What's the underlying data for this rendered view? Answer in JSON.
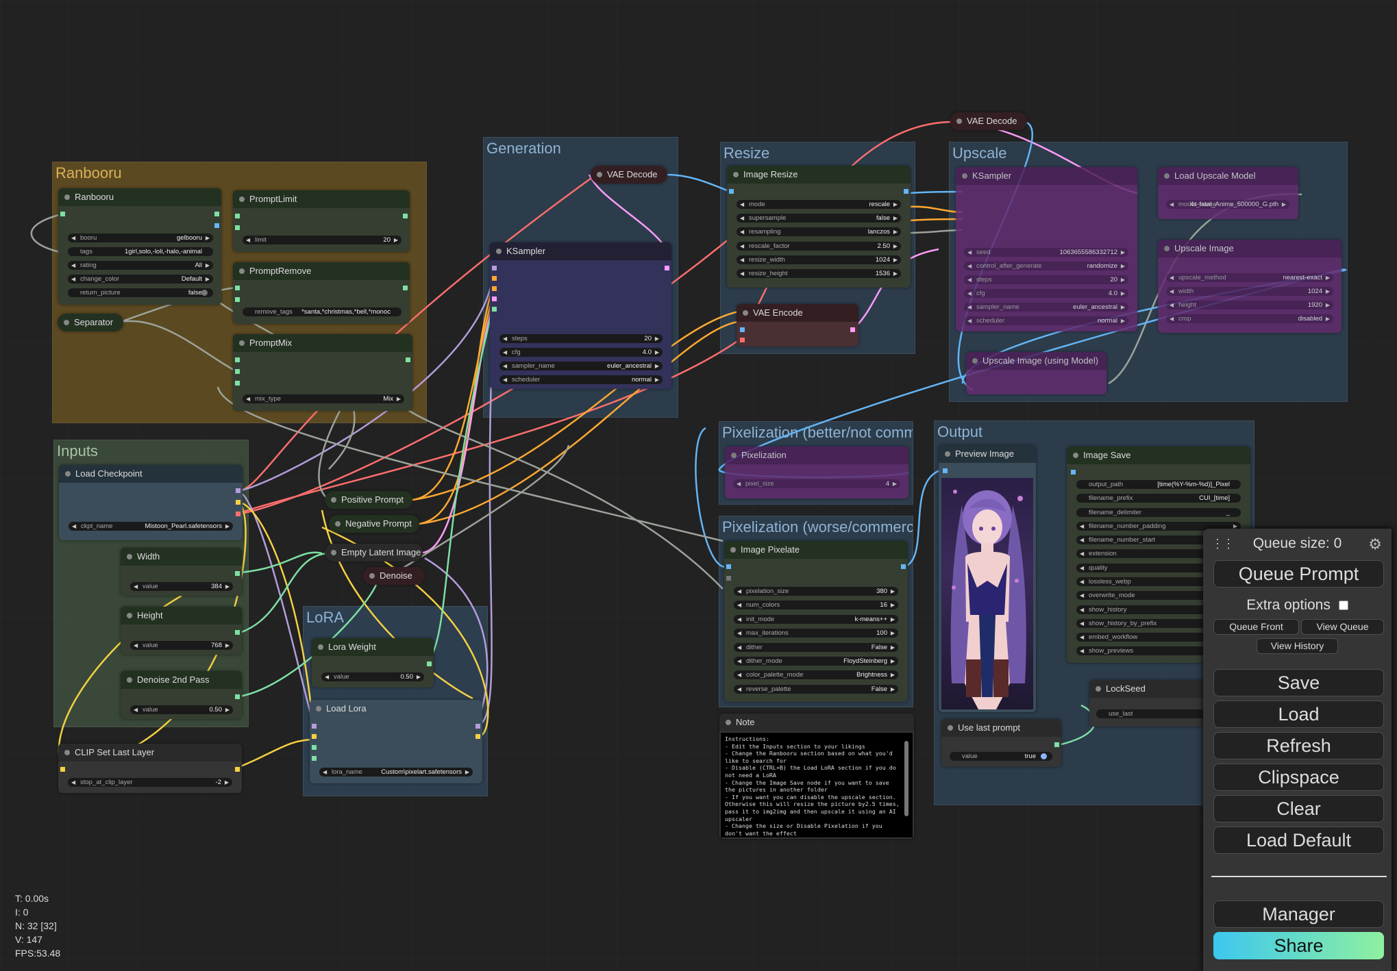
{
  "groups": {
    "ranbooru": "Ranbooru",
    "inputs": "Inputs",
    "generation": "Generation",
    "resize": "Resize",
    "upscale": "Upscale",
    "lora": "LoRA",
    "pix_better": "Pixelization (better/not commercial)",
    "pix_worse": "Pixelization (worse/commercial)",
    "output": "Output"
  },
  "nodes": {
    "ranbooru": {
      "title": "Ranbooru",
      "widgets": [
        {
          "name": "booru",
          "value": "gelbooru"
        },
        {
          "name": "tags",
          "value": "1girl,solo,-loli,-halo,-animal"
        },
        {
          "name": "rating",
          "value": "All"
        },
        {
          "name": "change_color",
          "value": "Default"
        },
        {
          "name": "return_picture",
          "value": "false"
        }
      ]
    },
    "separator": {
      "title": "Separator"
    },
    "promptlimit": {
      "title": "PromptLimit",
      "widgets": [
        {
          "name": "limit",
          "value": "20"
        }
      ]
    },
    "promptremove": {
      "title": "PromptRemove",
      "widgets": [
        {
          "name": "remove_tags",
          "value": "*santa,*christmas,*bell,*monoc"
        }
      ]
    },
    "promptmix": {
      "title": "PromptMix",
      "widgets": [
        {
          "name": "mix_type",
          "value": "Mix"
        }
      ]
    },
    "loadcheckpoint": {
      "title": "Load Checkpoint",
      "widgets": [
        {
          "name": "ckpt_name",
          "value": "Mistoon_Pearl.safetensors"
        }
      ]
    },
    "width": {
      "title": "Width",
      "widgets": [
        {
          "name": "value",
          "value": "384"
        }
      ]
    },
    "height": {
      "title": "Height",
      "widgets": [
        {
          "name": "value",
          "value": "768"
        }
      ]
    },
    "denoise2": {
      "title": "Denoise 2nd Pass",
      "widgets": [
        {
          "name": "value",
          "value": "0.50"
        }
      ]
    },
    "clipsetlast": {
      "title": "CLIP Set Last Layer",
      "widgets": [
        {
          "name": "stop_at_clip_layer",
          "value": "-2"
        }
      ]
    },
    "positive": {
      "title": "Positive Prompt"
    },
    "negative": {
      "title": "Negative Prompt"
    },
    "emptylatent": {
      "title": "Empty Latent Image"
    },
    "denoise": {
      "title": "Denoise"
    },
    "loraweight": {
      "title": "Lora Weight",
      "widgets": [
        {
          "name": "value",
          "value": "0.50"
        }
      ]
    },
    "loadlora": {
      "title": "Load Lora",
      "widgets": [
        {
          "name": "lora_name",
          "value": "Custom\\pixelart.safetensors"
        }
      ]
    },
    "vaedecode1": {
      "title": "VAE Decode"
    },
    "ksampler": {
      "title": "KSampler",
      "widgets": [
        {
          "name": "steps",
          "value": "20"
        },
        {
          "name": "cfg",
          "value": "4.0"
        },
        {
          "name": "sampler_name",
          "value": "euler_ancestral"
        },
        {
          "name": "scheduler",
          "value": "normal"
        }
      ]
    },
    "imageresize": {
      "title": "Image Resize",
      "widgets": [
        {
          "name": "mode",
          "value": "rescale"
        },
        {
          "name": "supersample",
          "value": "false"
        },
        {
          "name": "resampling",
          "value": "lanczos"
        },
        {
          "name": "rescale_factor",
          "value": "2.50"
        },
        {
          "name": "resize_width",
          "value": "1024"
        },
        {
          "name": "resize_height",
          "value": "1536"
        }
      ]
    },
    "vaeencode": {
      "title": "VAE Encode"
    },
    "vaedecode2": {
      "title": "VAE Decode"
    },
    "ksampler2": {
      "title": "KSampler",
      "widgets": [
        {
          "name": "seed",
          "value": "1063655586332712"
        },
        {
          "name": "control_after_generate",
          "value": "randomize"
        },
        {
          "name": "steps",
          "value": "20"
        },
        {
          "name": "cfg",
          "value": "4.0"
        },
        {
          "name": "sampler_name",
          "value": "euler_ancestral"
        },
        {
          "name": "scheduler",
          "value": "normal"
        }
      ]
    },
    "loadupscale": {
      "title": "Load Upscale Model",
      "widgets": [
        {
          "name": "model_name",
          "value": "4x-fatal_Anime_500000_G.pth"
        }
      ]
    },
    "upscaleimage": {
      "title": "Upscale Image",
      "widgets": [
        {
          "name": "upscale_method",
          "value": "nearest-exact"
        },
        {
          "name": "width",
          "value": "1024"
        },
        {
          "name": "height",
          "value": "1920"
        },
        {
          "name": "crop",
          "value": "disabled"
        }
      ]
    },
    "upscalemodel": {
      "title": "Upscale Image (using Model)"
    },
    "pixelization": {
      "title": "Pixelization",
      "widgets": [
        {
          "name": "pixel_size",
          "value": "4"
        }
      ]
    },
    "imagepixelate": {
      "title": "Image Pixelate",
      "widgets": [
        {
          "name": "pixelation_size",
          "value": "380"
        },
        {
          "name": "num_colors",
          "value": "16"
        },
        {
          "name": "init_mode",
          "value": "k-means++"
        },
        {
          "name": "max_iterations",
          "value": "100"
        },
        {
          "name": "dither",
          "value": "False"
        },
        {
          "name": "dither_mode",
          "value": "FloydSteinberg"
        },
        {
          "name": "color_palette_mode",
          "value": "Brightness"
        },
        {
          "name": "reverse_palette",
          "value": "False"
        }
      ]
    },
    "note": {
      "title": "Note",
      "text": "Instructions:\n- Edit the Inputs section to your likings\n- Change the Ranbooru section based on what you'd like to search for\n- Disable (CTRL+B) the Load LoRA section if you do not need a LoRA\n- Change the Image Save node if you want to save the pictures in another folder\n- If you want you can disable the upscale section. Otherwise this will resize the picture by2.5 times, pass it to img2img and then upscale it using an AI upscaler\n- Change the size or Disable Pixelation if you don't want the effect"
    },
    "previewimage": {
      "title": "Preview Image"
    },
    "imagesave": {
      "title": "Image Save",
      "widgets": [
        {
          "name": "output_path",
          "value": "[time(%Y-%m-%d)]_Pixel"
        },
        {
          "name": "filename_prefix",
          "value": "CUI_[time]"
        },
        {
          "name": "filename_delimiter",
          "value": "_"
        },
        {
          "name": "filename_number_padding",
          "value": ""
        },
        {
          "name": "filename_number_start",
          "value": ""
        },
        {
          "name": "extension",
          "value": ""
        },
        {
          "name": "quality",
          "value": ""
        },
        {
          "name": "lossless_webp",
          "value": ""
        },
        {
          "name": "overwrite_mode",
          "value": ""
        },
        {
          "name": "show_history",
          "value": ""
        },
        {
          "name": "show_history_by_prefix",
          "value": ""
        },
        {
          "name": "embed_workflow",
          "value": ""
        },
        {
          "name": "show_previews",
          "value": ""
        }
      ]
    },
    "lockseed": {
      "title": "LockSeed",
      "widgets": [
        {
          "name": "use_last",
          "value": "tr"
        }
      ]
    },
    "uselastprompt": {
      "title": "Use last prompt",
      "widgets": [
        {
          "name": "value",
          "value": "true"
        }
      ]
    }
  },
  "stats": {
    "t": "T: 0.00s",
    "i": "I: 0",
    "n": "N: 32 [32]",
    "v": "V: 147",
    "fps": "FPS:53.48"
  },
  "menu": {
    "queue_size": "Queue size: 0",
    "queue_prompt": "Queue Prompt",
    "extra_options": "Extra options",
    "queue_front": "Queue Front",
    "view_queue": "View Queue",
    "view_history": "View History",
    "save": "Save",
    "load": "Load",
    "refresh": "Refresh",
    "clipspace": "Clipspace",
    "clear": "Clear",
    "load_default": "Load Default",
    "manager": "Manager",
    "share": "Share"
  },
  "colors": {
    "clip": "#f5d142",
    "model": "#b39ddb",
    "vae": "#ff6e6e",
    "latent": "#ff9cf9",
    "image": "#64b5f6",
    "conditioning": "#ffa931",
    "int": "#7ee0a4",
    "string": "#9ca39a"
  }
}
